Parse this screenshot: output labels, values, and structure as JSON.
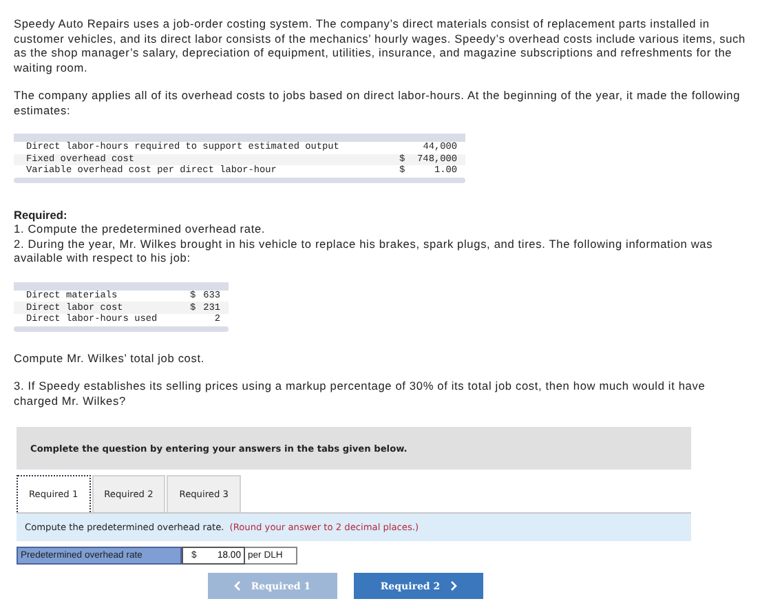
{
  "intro": [
    "Speedy Auto Repairs uses a job-order costing system. The company’s direct materials consist of replacement parts installed in customer vehicles, and its direct labor consists of the mechanics’ hourly wages. Speedy’s overhead costs include various items, such as the shop manager’s salary, depreciation of equipment, utilities, insurance, and magazine subscriptions and refreshments for the waiting room.",
    "The company applies all of its overhead costs to jobs based on direct labor-hours. At the beginning of the year, it made the following estimates:"
  ],
  "estimates": [
    {
      "label": "Direct labor-hours required to support estimated output",
      "amount": "44,000"
    },
    {
      "label": "Fixed overhead cost",
      "currency": "$",
      "amount": "748,000"
    },
    {
      "label": "Variable overhead cost per direct labor-hour",
      "currency": "$",
      "amount": "1.00"
    }
  ],
  "required": {
    "heading": "Required:",
    "items": [
      "1. Compute the predetermined overhead rate.",
      "2. During the year, Mr. Wilkes brought in his vehicle to replace his brakes, spark plugs, and tires. The following information was available with respect to his job:"
    ]
  },
  "job": [
    {
      "label": "Direct materials",
      "currency": "$",
      "amount": "633"
    },
    {
      "label": "Direct labor cost",
      "currency": "$",
      "amount": "231"
    },
    {
      "label": "Direct labor-hours used",
      "amount": "2"
    }
  ],
  "after_job": [
    "Compute Mr. Wilkes’ total job cost.",
    "3. If Speedy establishes its selling prices using a markup percentage of 30% of its total job cost, then how much would it have charged Mr. Wilkes?"
  ],
  "instructions": "Complete the question by entering your answers in the tabs given below.",
  "tabs": [
    {
      "label": "Required 1",
      "selected": true
    },
    {
      "label": "Required 2",
      "selected": false
    },
    {
      "label": "Required 3",
      "selected": false
    }
  ],
  "prompt": {
    "text": "Compute the predetermined overhead rate.",
    "hint": "(Round your answer to 2 decimal places.)"
  },
  "answer": {
    "label": "Predetermined overhead rate",
    "currency": "$",
    "value": "18.00",
    "unit": "per DLH"
  },
  "nav": [
    {
      "kind": "prev",
      "label": "Required 1",
      "disabled": true
    },
    {
      "kind": "next",
      "label": "Required 2",
      "disabled": false
    }
  ]
}
